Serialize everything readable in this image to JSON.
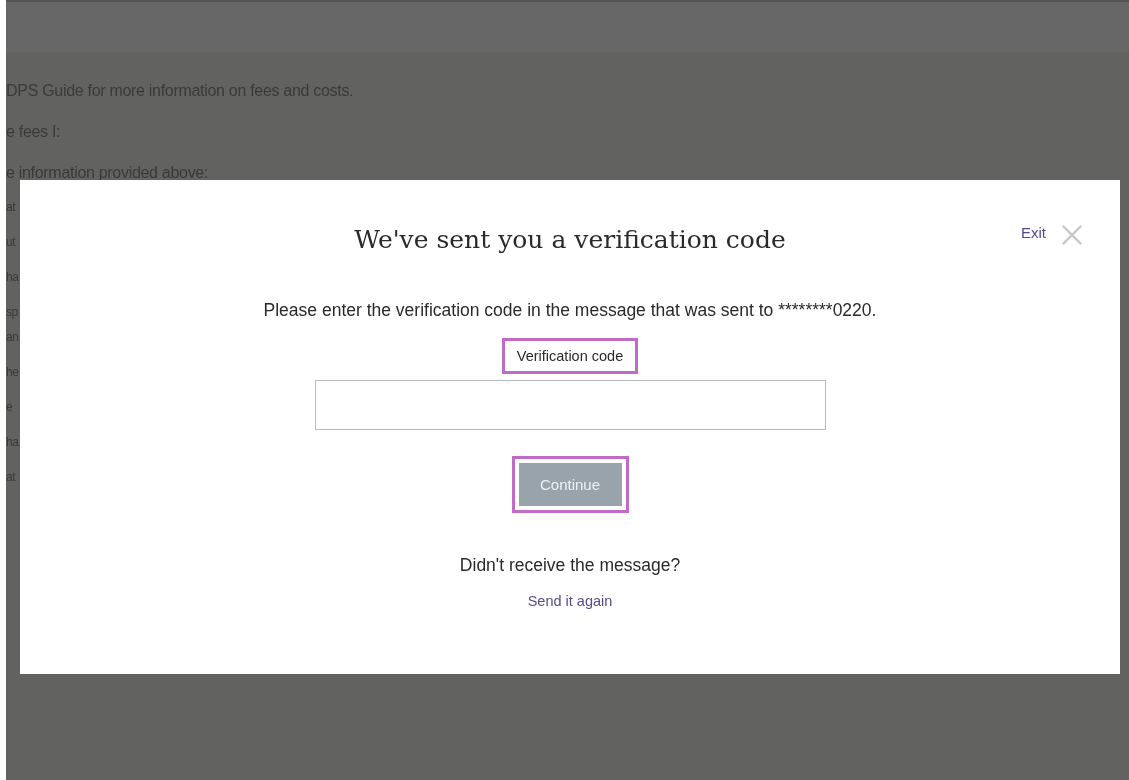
{
  "background_page": {
    "lines": [
      "DPS Guide for more information on fees and costs.",
      "e fees I:",
      "e information provided above:"
    ],
    "left_fragments": [
      "at",
      "ut",
      "ha",
      "sp",
      "an",
      "he",
      "e",
      "ha",
      "at"
    ]
  },
  "dialog": {
    "title": "We've sent you a verification code",
    "exit_label": "Exit",
    "message": "Please enter the verification code in the message that was sent to ********0220.",
    "field": {
      "label": "Verification code",
      "label_highlighted": true
    },
    "continue_button": {
      "label": "Continue",
      "disabled": true,
      "highlighted": true
    },
    "resend_prompt": "Didn't receive the message?",
    "resend_link": "Send it again"
  }
}
